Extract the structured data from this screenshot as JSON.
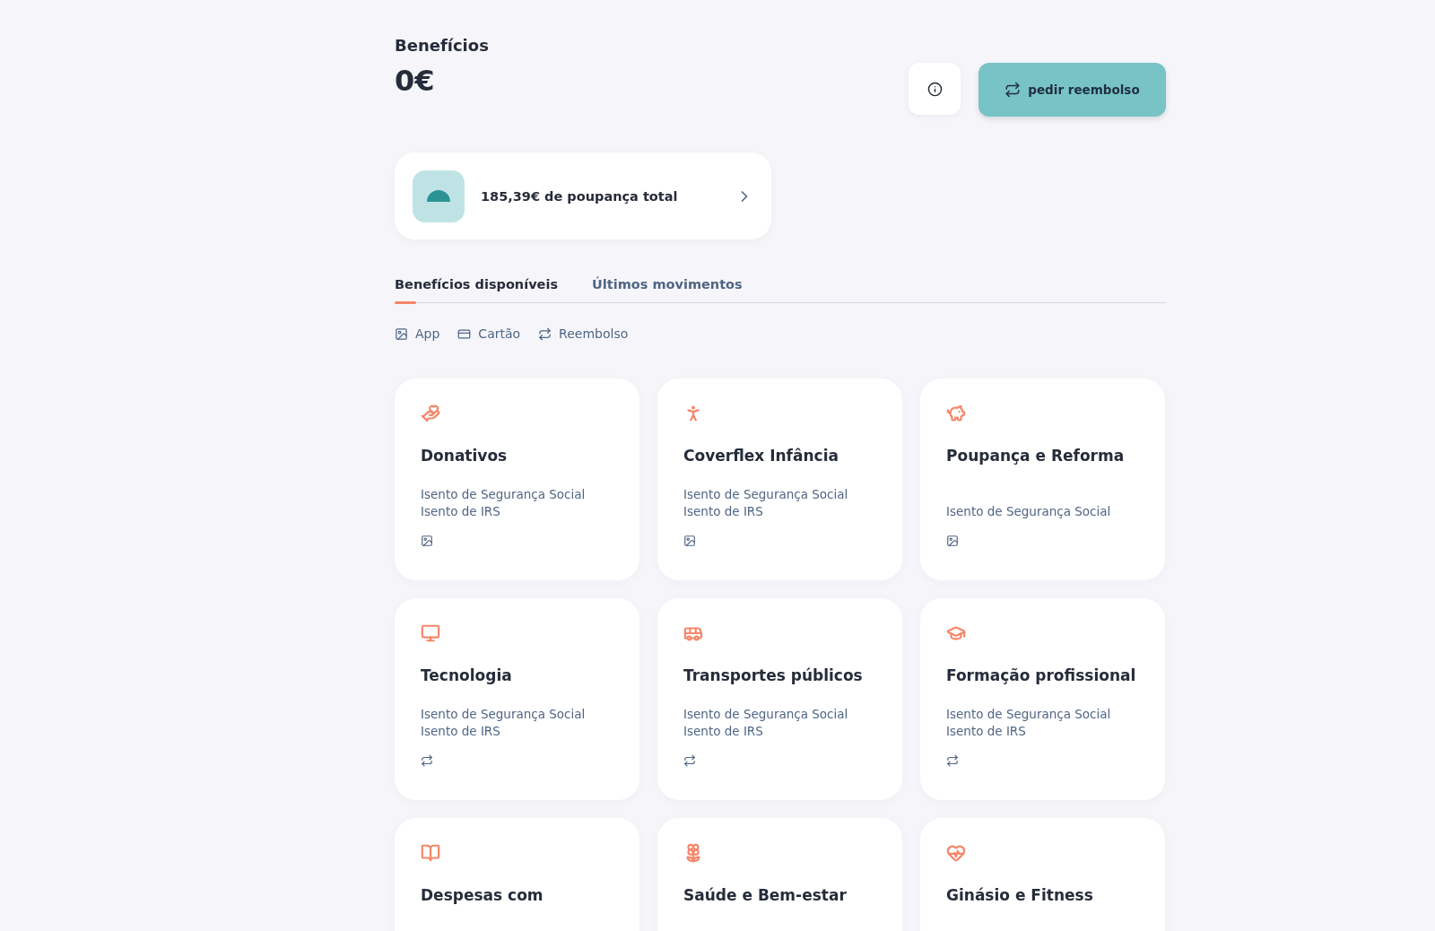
{
  "header": {
    "title": "Benefícios",
    "amount": "0€"
  },
  "actions": {
    "refund_button": "pedir reembolso"
  },
  "savings": {
    "text": "185,39€ de poupança total"
  },
  "tabs": [
    {
      "label": "Benefícios disponíveis",
      "selected": true
    },
    {
      "label": "Últimos movimentos",
      "selected": false
    }
  ],
  "legend": [
    {
      "kind": "app",
      "label": "App"
    },
    {
      "kind": "card",
      "label": "Cartão"
    },
    {
      "kind": "refund",
      "label": "Reembolso"
    }
  ],
  "benefits": [
    {
      "title": "Donativos",
      "lines": [
        "Isento de Segurança Social",
        "Isento de IRS"
      ],
      "kind": "app"
    },
    {
      "title": "Coverflex Infância",
      "lines": [
        "Isento de Segurança Social",
        "Isento de IRS"
      ],
      "kind": "app"
    },
    {
      "title": "Poupança e Reforma",
      "lines": [
        "Isento de Segurança Social"
      ],
      "kind": "app"
    },
    {
      "title": "Tecnologia",
      "lines": [
        "Isento de Segurança Social",
        "Isento de IRS"
      ],
      "kind": "refund"
    },
    {
      "title": "Transportes públicos",
      "lines": [
        "Isento de Segurança Social",
        "Isento de IRS"
      ],
      "kind": "refund"
    },
    {
      "title": "Formação profissional",
      "lines": [
        "Isento de Segurança Social",
        "Isento de IRS"
      ],
      "kind": "refund"
    },
    {
      "title": "Despesas com"
    },
    {
      "title": "Saúde e Bem-estar"
    },
    {
      "title": "Ginásio e Fitness"
    }
  ]
}
